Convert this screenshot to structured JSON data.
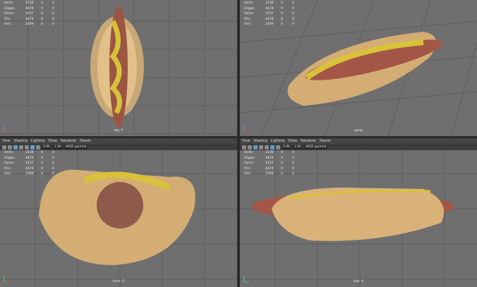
{
  "stats": {
    "labels": [
      "Verts:",
      "Edges:",
      "Faces:",
      "Tris:",
      "UVs:"
    ],
    "values": [
      [
        "2239",
        "0",
        "0"
      ],
      [
        "4474",
        "0",
        "0"
      ],
      [
        "2237",
        "0",
        "0"
      ],
      [
        "4474",
        "0",
        "0"
      ],
      [
        "2309",
        "0",
        "0"
      ]
    ]
  },
  "menu": [
    "View",
    "Shading",
    "Lighting",
    "Show",
    "Renderer",
    "Panels"
  ],
  "toolbar": {
    "near": "0.00",
    "far": "1.00",
    "colorspace": "sRGB gamma"
  },
  "viewports": [
    {
      "name": "top -Y"
    },
    {
      "name": "persp"
    },
    {
      "name": "front -Z"
    },
    {
      "name": "side -X"
    }
  ],
  "colors": {
    "viewport_bg": "#6f6f6f",
    "grid": "#5d5d5d",
    "bun": "#d9b27a",
    "sausage": "#a85a4a",
    "mustard": "#d8c23a"
  }
}
